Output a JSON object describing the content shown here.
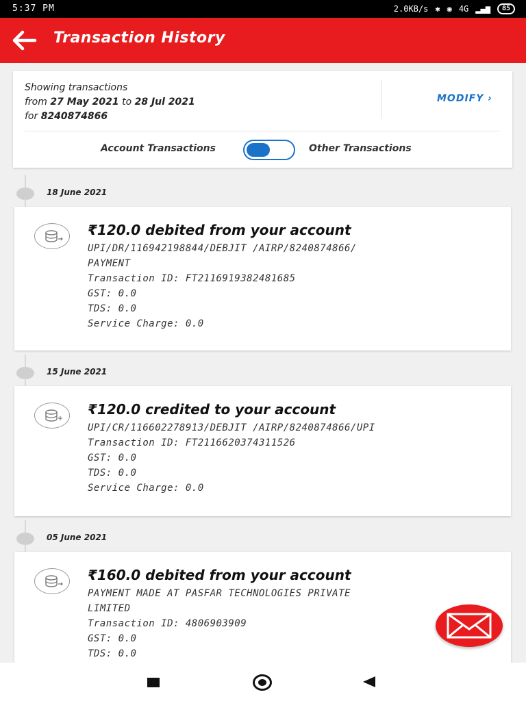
{
  "status_bar": {
    "time": "5:37 PM",
    "net_speed": "2.0KB/s",
    "signal": "4G",
    "battery": "85"
  },
  "app_bar": {
    "title": "Transaction History"
  },
  "filter": {
    "line1": "Showing transactions",
    "from_prefix": "from",
    "from_date": "27 May 2021",
    "to_word": "to",
    "to_date": "28 Jul 2021",
    "for_prefix": "for",
    "account": "8240874866",
    "modify_label": "MODIFY ›",
    "toggle_left_label": "Account Transactions",
    "toggle_right_label": "Other Transactions"
  },
  "transactions": [
    {
      "date": "18 June 2021",
      "title": "₹120.0 debited from your account",
      "lines": [
        "UPI/DR/116942198844/DEBJIT  /AIRP/8240874866/",
        "PAYMENT",
        "Transaction ID: FT2116919382481685",
        "GST: 0.0",
        "TDS: 0.0",
        "Service Charge: 0.0"
      ]
    },
    {
      "date": "15 June 2021",
      "title": "₹120.0 credited to your account",
      "lines": [
        "UPI/CR/116602278913/DEBJIT  /AIRP/8240874866/UPI",
        "Transaction ID: FT2116620374311526",
        "GST: 0.0",
        "TDS: 0.0",
        "Service Charge: 0.0"
      ]
    },
    {
      "date": "05 June 2021",
      "title": "₹160.0 debited from your account",
      "lines": [
        "PAYMENT MADE AT PASFAR TECHNOLOGIES PRIVATE",
        "LIMITED",
        "Transaction ID: 4806903909",
        "GST: 0.0",
        "TDS: 0.0"
      ]
    }
  ],
  "icons": {
    "back": "arrow-left-icon",
    "txn": "coins-icon",
    "fab": "mail-icon"
  },
  "colors": {
    "brand_red": "#e81b1e",
    "accent_blue": "#1a73c8"
  }
}
